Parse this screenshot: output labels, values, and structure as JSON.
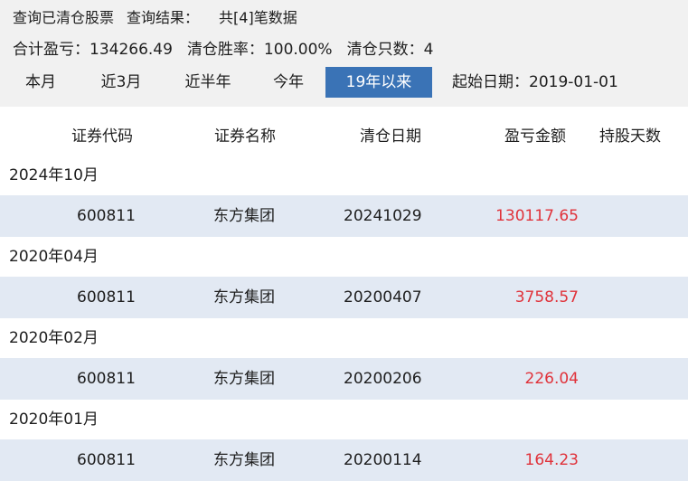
{
  "summary": {
    "title": "查询已清仓股票",
    "result_label": "查询结果：",
    "result_count": "共[4]笔数据",
    "total_pl": "合计盈亏：134266.49",
    "win_rate": "清仓胜率：100.00%",
    "count": "清仓只数：4"
  },
  "tabs": [
    {
      "label": "本月",
      "active": false
    },
    {
      "label": "近3月",
      "active": false
    },
    {
      "label": "近半年",
      "active": false
    },
    {
      "label": "今年",
      "active": false
    },
    {
      "label": "19年以来",
      "active": true
    }
  ],
  "start_date": "起始日期：2019-01-01",
  "columns": {
    "code": "证券代码",
    "name": "证券名称",
    "date": "清仓日期",
    "pl": "盈亏金额",
    "days": "持股天数"
  },
  "groups": [
    {
      "month": "2024年10月",
      "rows": [
        {
          "code": "600811",
          "name": "东方集团",
          "date": "20241029",
          "pl": "130117.65",
          "days": ""
        }
      ]
    },
    {
      "month": "2020年04月",
      "rows": [
        {
          "code": "600811",
          "name": "东方集团",
          "date": "20200407",
          "pl": "3758.57",
          "days": ""
        }
      ]
    },
    {
      "month": "2020年02月",
      "rows": [
        {
          "code": "600811",
          "name": "东方集团",
          "date": "20200206",
          "pl": "226.04",
          "days": ""
        }
      ]
    },
    {
      "month": "2020年01月",
      "rows": [
        {
          "code": "600811",
          "name": "东方集团",
          "date": "20200114",
          "pl": "164.23",
          "days": ""
        }
      ]
    }
  ],
  "colors": {
    "accent": "#3a73b6",
    "profit": "#e0323a",
    "row_bg": "#e2e9f3",
    "top_bg": "#f1f1f1"
  }
}
